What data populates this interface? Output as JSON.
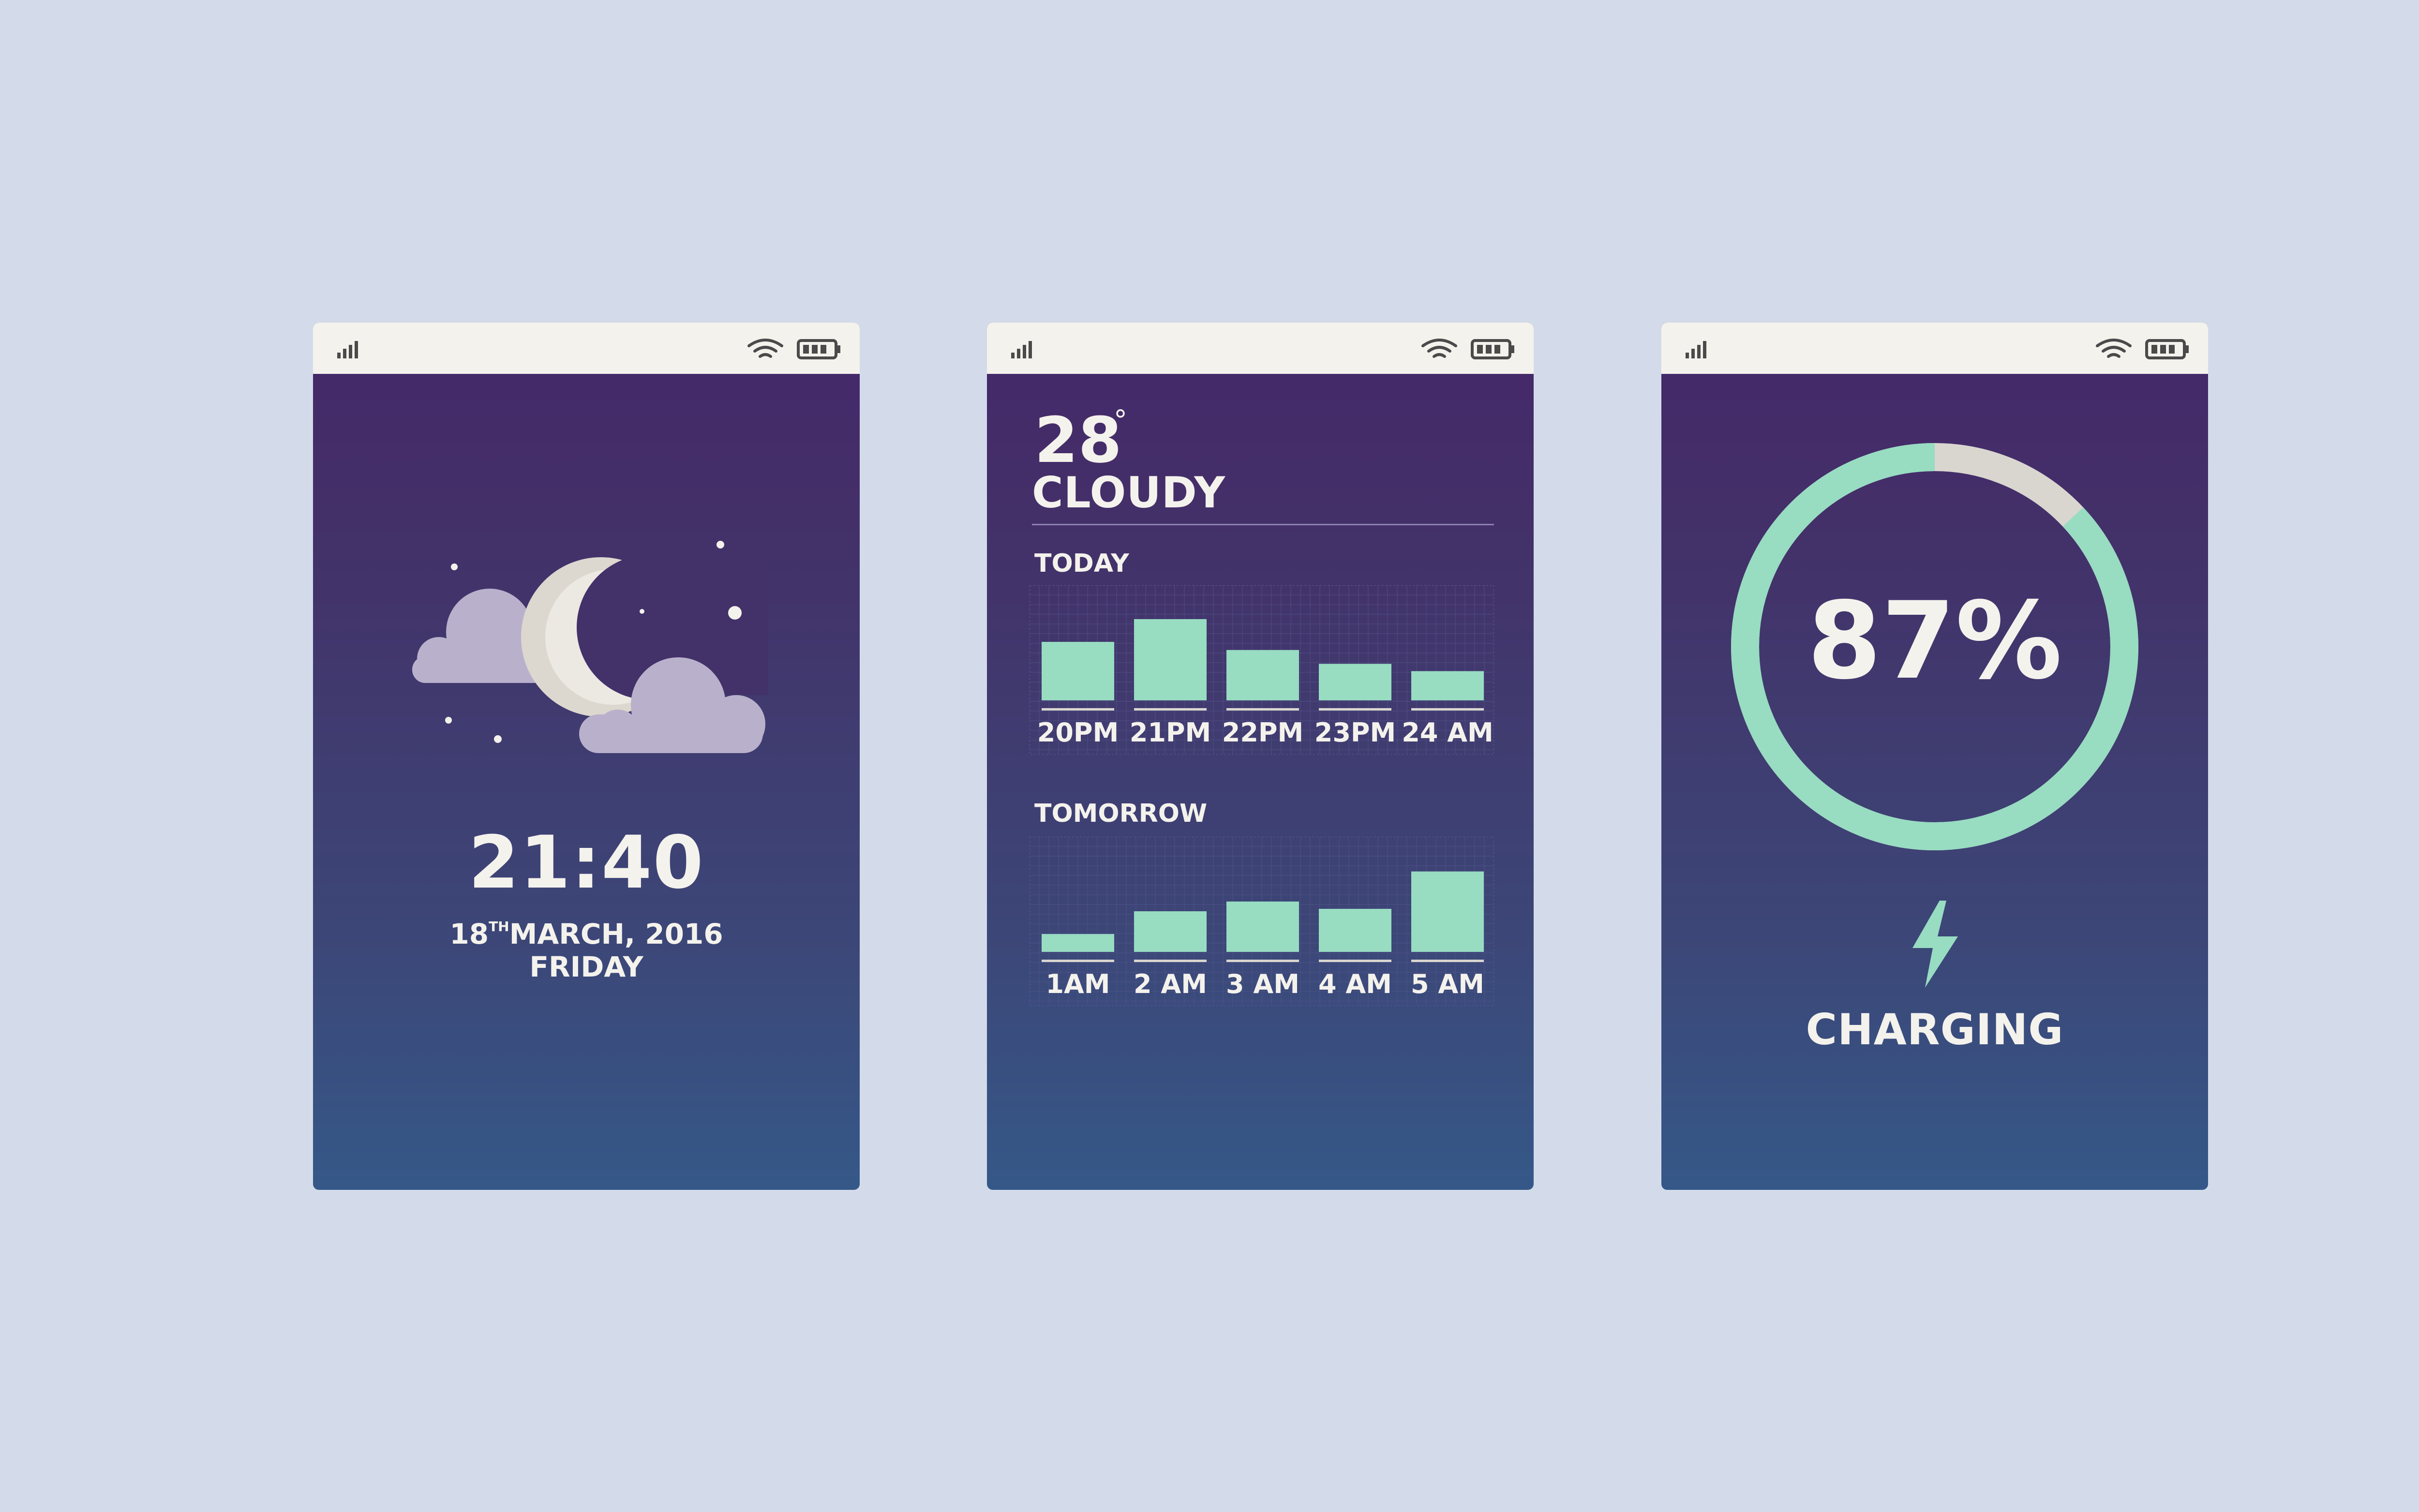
{
  "colors": {
    "background": "#d3dbea",
    "screen_top": "#452769",
    "screen_bottom": "#355888",
    "statusbar": "#f4f2ec",
    "accent": "#98dcc2",
    "ring_track": "#d9d6cf",
    "text": "#f4f2ec"
  },
  "status_icons": [
    "signal-icon",
    "wifi-icon",
    "battery-icon"
  ],
  "lock_screen": {
    "icons": [
      "moon-icon",
      "cloud-icon",
      "star-icon"
    ],
    "time": "21:40",
    "date_day": "18",
    "date_suffix": "TH",
    "date_rest": "MARCH, 2016",
    "weekday": "FRIDAY"
  },
  "weather_screen": {
    "temperature": "28",
    "degree": "°",
    "condition": "CLOUDY",
    "today_label": "TODAY",
    "tomorrow_label": "TOMORROW"
  },
  "chart_data": [
    {
      "type": "bar",
      "title": "TODAY",
      "categories": [
        "20PM",
        "21PM",
        "22PM",
        "23PM",
        "24 AM"
      ],
      "values": [
        0.72,
        1.0,
        0.62,
        0.45,
        0.36
      ]
    },
    {
      "type": "bar",
      "title": "TOMORROW",
      "categories": [
        "1AM",
        "2 AM",
        "3 AM",
        "4 AM",
        "5 AM"
      ],
      "values": [
        0.22,
        0.5,
        0.62,
        0.53,
        0.99
      ]
    }
  ],
  "battery_screen": {
    "percent_text": "87%",
    "level": 0.87,
    "status": "CHARGING",
    "icon": "lightning-bolt-icon"
  }
}
